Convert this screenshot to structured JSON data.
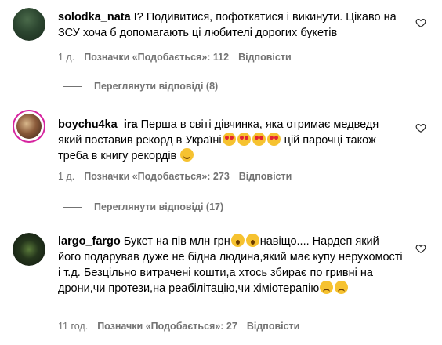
{
  "comments": [
    {
      "username": "solodka_nata",
      "text": "І? Подивитися, пофоткатися і викинути. Цікаво на ЗСУ хоча б допомагають ці любителі дорогих букетів",
      "time": "1 д.",
      "likes": "Позначки «Подобається»: 112",
      "reply": "Відповісти",
      "view_replies": "Переглянути відповіді (8)"
    },
    {
      "username": "boychu4ka_ira",
      "text_a": "Перша в світі дівчинка, яка отримає медведя який поставив рекорд в Україні",
      "text_b": " цій парочці також треба в книгу рекордів ",
      "time": "1 д.",
      "likes": "Позначки «Подобається»: 273",
      "reply": "Відповісти",
      "view_replies": "Переглянути відповіді (17)"
    },
    {
      "username": "largo_fargo",
      "text_a": "Букет на пів млн грн",
      "text_b": "навіщо.... Нардеп який його подарував дуже не бідна людина,який має купу нерухомості і т.д. Безцільно витрачені кошти,а хтось збирає по гривні на дрони,чи протези,на реабілітацію,чи хіміотерапію",
      "time": "11 год.",
      "likes": "Позначки «Подобається»: 27",
      "reply": "Відповісти"
    }
  ],
  "icons": {
    "like": "heart-outline-icon"
  },
  "colors": {
    "meta": "#737373",
    "story_ring": "#d6249f"
  }
}
